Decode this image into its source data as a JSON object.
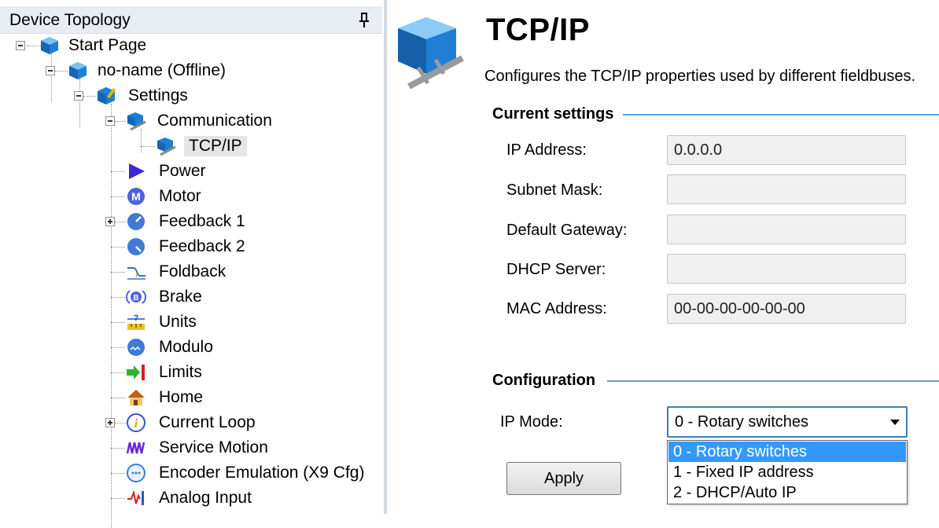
{
  "left_panel": {
    "title": "Device Topology",
    "tree": [
      {
        "label": "Start Page",
        "icon": "start-page-cube-icon"
      },
      {
        "label": "no-name (Offline)",
        "icon": "device-cube-icon"
      },
      {
        "label": "Settings",
        "icon": "settings-cube-icon"
      },
      {
        "label": "Communication",
        "icon": "communication-cube-icon"
      },
      {
        "label": "TCP/IP",
        "icon": "tcpip-cube-icon",
        "selected": true
      },
      {
        "label": "Power",
        "icon": "power-triangle-icon"
      },
      {
        "label": "Motor",
        "icon": "motor-m-icon"
      },
      {
        "label": "Feedback 1",
        "icon": "feedback-gauge-icon"
      },
      {
        "label": "Feedback 2",
        "icon": "feedback-gauge-icon"
      },
      {
        "label": "Foldback",
        "icon": "foldback-curve-icon"
      },
      {
        "label": "Brake",
        "icon": "brake-b-icon"
      },
      {
        "label": "Units",
        "icon": "units-ruler-icon"
      },
      {
        "label": "Modulo",
        "icon": "modulo-gauge-icon"
      },
      {
        "label": "Limits",
        "icon": "limits-arrow-icon"
      },
      {
        "label": "Home",
        "icon": "home-house-icon"
      },
      {
        "label": "Current Loop",
        "icon": "current-loop-info-icon"
      },
      {
        "label": "Service Motion",
        "icon": "service-motion-wave-icon"
      },
      {
        "label": "Encoder Emulation (X9 Cfg)",
        "icon": "encoder-emulation-icon"
      },
      {
        "label": "Analog Input",
        "icon": "analog-input-icon"
      }
    ]
  },
  "main": {
    "title": "TCP/IP",
    "description": "Configures the TCP/IP properties used by different fieldbuses.",
    "current_settings": {
      "title": "Current settings",
      "fields": [
        {
          "label": "IP Address:",
          "value": "0.0.0.0"
        },
        {
          "label": "Subnet Mask:",
          "value": ""
        },
        {
          "label": "Default Gateway:",
          "value": ""
        },
        {
          "label": "DHCP Server:",
          "value": ""
        },
        {
          "label": "MAC Address:",
          "value": "00-00-00-00-00-00"
        }
      ]
    },
    "configuration": {
      "title": "Configuration",
      "ip_mode_label": "IP Mode:",
      "ip_mode_selected": "0 - Rotary switches",
      "ip_mode_options": [
        "0 - Rotary switches",
        "1 - Fixed IP address",
        "2 - DHCP/Auto IP"
      ]
    },
    "apply_label": "Apply"
  },
  "colors": {
    "accent_line": "#5aa3e0",
    "selection": "#3399ff",
    "cube_blue": "#1e7fd4"
  }
}
